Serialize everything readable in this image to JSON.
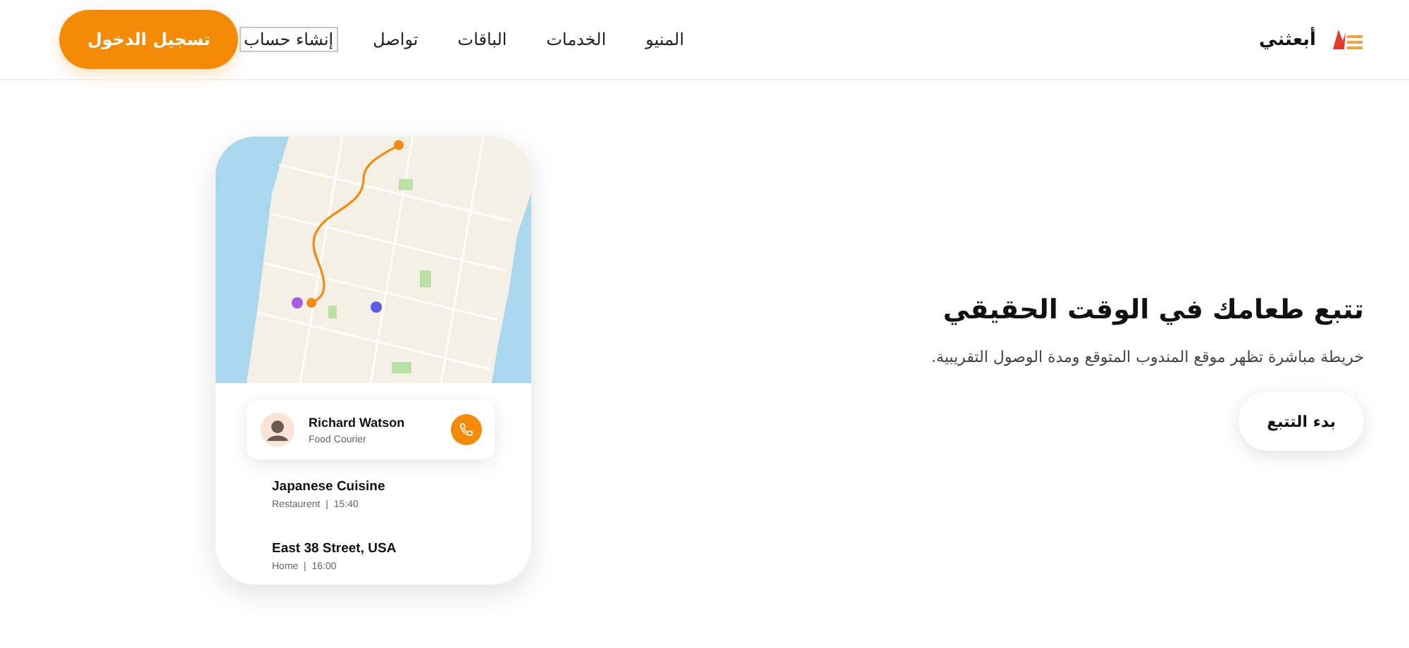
{
  "header": {
    "brand": "أبعثني",
    "nav": [
      {
        "label": "المنيو",
        "focused": false
      },
      {
        "label": "الخدمات",
        "focused": false
      },
      {
        "label": "الباقات",
        "focused": false
      },
      {
        "label": "تواصل",
        "focused": false
      },
      {
        "label": "إنشاء حساب",
        "focused": true
      }
    ],
    "login_button": "تسجيل الدخول"
  },
  "hero": {
    "title": "تتبع طعامك في الوقت الحقيقي",
    "subtitle": "خريطة مباشرة تظهر موقع المندوب المتوقع ومدة الوصول التقريبية.",
    "button": "بدء التتبع"
  },
  "phone": {
    "courier": {
      "name": "Richard Watson",
      "role": "Food Courier"
    },
    "stops": [
      {
        "title": "Japanese Cuisine",
        "type": "Restaurent",
        "separator": "|",
        "time": "15:40"
      },
      {
        "title": "East 38 Street, USA",
        "type": "Home",
        "separator": "|",
        "time": "16:00"
      }
    ]
  }
}
